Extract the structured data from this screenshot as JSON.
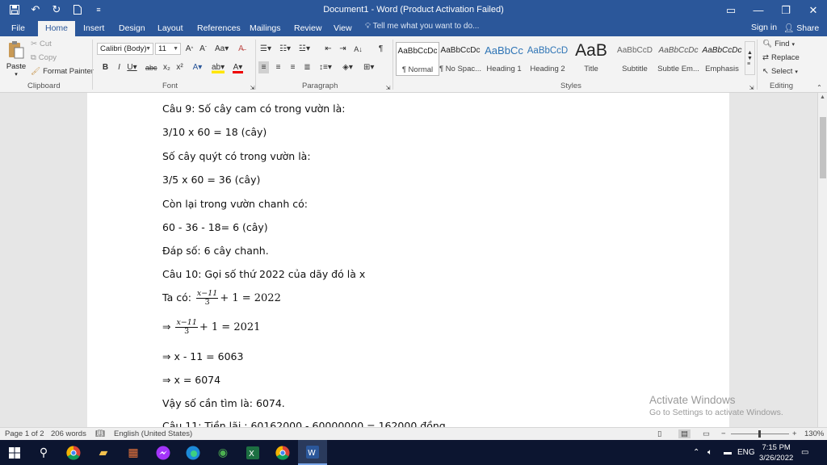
{
  "window": {
    "title": "Document1 - Word (Product Activation Failed)"
  },
  "tabs": [
    {
      "label": "File"
    },
    {
      "label": "Home"
    },
    {
      "label": "Insert"
    },
    {
      "label": "Design"
    },
    {
      "label": "Layout"
    },
    {
      "label": "References"
    },
    {
      "label": "Mailings"
    },
    {
      "label": "Review"
    },
    {
      "label": "View"
    }
  ],
  "tell_me": "Tell me what you want to do...",
  "sign_in": "Sign in",
  "share": "Share",
  "clipboard": {
    "paste": "Paste",
    "cut": "Cut",
    "copy": "Copy",
    "format_painter": "Format Painter",
    "group_label": "Clipboard"
  },
  "font": {
    "font_name": "Calibri (Body)",
    "font_size": "11",
    "group_label": "Font"
  },
  "paragraph": {
    "group_label": "Paragraph"
  },
  "styles": {
    "group_label": "Styles",
    "items": [
      {
        "preview": "AaBbCcDc",
        "label": "¶ Normal"
      },
      {
        "preview": "AaBbCcDc",
        "label": "¶ No Spac..."
      },
      {
        "preview": "AaBbCc",
        "label": "Heading 1"
      },
      {
        "preview": "AaBbCcD",
        "label": "Heading 2"
      },
      {
        "preview": "AaB",
        "label": "Title"
      },
      {
        "preview": "AaBbCcD",
        "label": "Subtitle"
      },
      {
        "preview": "AaBbCcDc",
        "label": "Subtle Em..."
      },
      {
        "preview": "AaBbCcDc",
        "label": "Emphasis"
      }
    ],
    "selected_index": 0
  },
  "editing": {
    "find": "Find",
    "replace": "Replace",
    "select": "Select",
    "group_label": "Editing"
  },
  "document": {
    "lines": [
      "Câu 9: Số cây cam có trong vườn là:",
      "3/10 x 60 = 18 (cây)",
      "Số cây quýt có trong vườn là:",
      "3/5 x 60 = 36 (cây)",
      "Còn lại trong vườn chanh có:",
      "60 - 36 - 18= 6 (cây)",
      "Đáp số: 6 cây chanh.",
      "Câu 10: Gọi số thứ 2022 của dãy đó là x"
    ],
    "eq1": {
      "prefix": "Ta có: ",
      "num": "x−11",
      "den": "3",
      "rest": "+ 1 = 2022"
    },
    "eq2": {
      "prefix": "⇒ ",
      "num": "x−11",
      "den": "3",
      "rest": "+ 1 = 2021"
    },
    "lines_after": [
      "⇒ x - 11 = 6063",
      "⇒ x = 6074",
      "Vậy số cần tìm là: 6074.",
      "Câu 11: Tiền lãi : 60162000 - 60000000 = 162000 đồng"
    ]
  },
  "activation": {
    "line1": "Activate Windows",
    "line2": "Go to Settings to activate Windows."
  },
  "status": {
    "page": "Page 1 of 2",
    "words": "206 words",
    "language": "English (United States)",
    "zoom": "130%"
  },
  "taskbar": {
    "language": "ENG",
    "time": "7:15 PM",
    "date": "3/26/2022"
  },
  "colors": {
    "accent": "#2b579a",
    "taskbar": "#0c1530"
  }
}
